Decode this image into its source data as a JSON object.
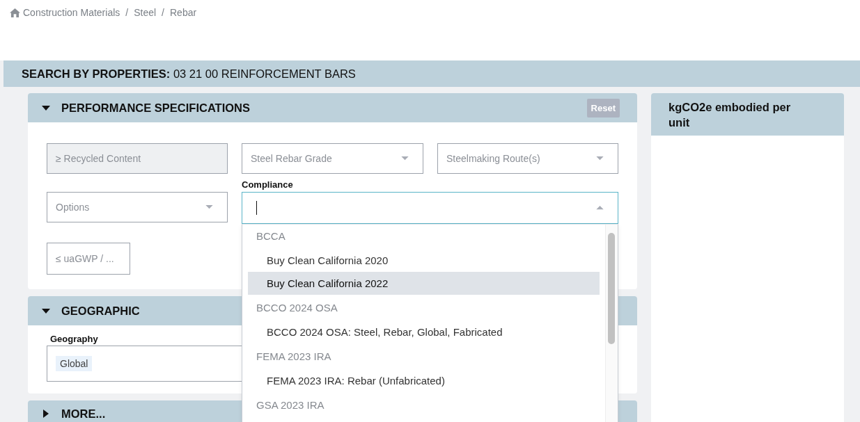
{
  "breadcrumb": {
    "separator": "/",
    "items": [
      "Construction Materials",
      "Steel",
      "Rebar"
    ]
  },
  "title": "**SEARCH BY PROPERTIES:** 03 21 00 REINFORCEMENT BARS",
  "performance": {
    "title": "PERFORMANCE SPECIFICATIONS",
    "expanded": true,
    "reset_button": "Reset",
    "fields": [
      {
        "kind": "number",
        "placeholder": "≥ Recycled Content",
        "disabled": true
      },
      {
        "kind": "select",
        "placeholder": "Steel Rebar Grade"
      },
      {
        "kind": "select",
        "placeholder": "Steelmaking Route(s)"
      },
      {
        "kind": "select",
        "placeholder": "Options"
      },
      {
        "kind": "combo",
        "label": "Compliance",
        "open": true,
        "options": [
          {
            "group": "BCCA",
            "items": [
              {
                "label": "Buy Clean California 2020",
                "highlighted": false
              },
              {
                "label": "Buy Clean California 2022",
                "highlighted": true
              }
            ]
          },
          {
            "group": "BCCO 2024 OSA",
            "items": [
              {
                "label": "BCCO 2024 OSA: Steel, Rebar, Global, Fabricated",
                "highlighted": false
              }
            ]
          },
          {
            "group": "FEMA 2023 IRA",
            "items": [
              {
                "label": "FEMA 2023 IRA: Rebar (Unfabricated)",
                "highlighted": false
              }
            ]
          },
          {
            "group": "GSA 2023 IRA"
          }
        ]
      },
      {
        "kind": "number",
        "placeholder": "≤ uaGWP / ...",
        "disabled": false
      }
    ]
  },
  "geographic": {
    "title": "GEOGRAPHIC",
    "expanded": true,
    "label": "Geography",
    "chips": [
      "Global"
    ]
  },
  "more": {
    "title": "MORE...",
    "expanded": false
  },
  "side_panel": {
    "title": "kgCO2e embodied per unit"
  }
}
